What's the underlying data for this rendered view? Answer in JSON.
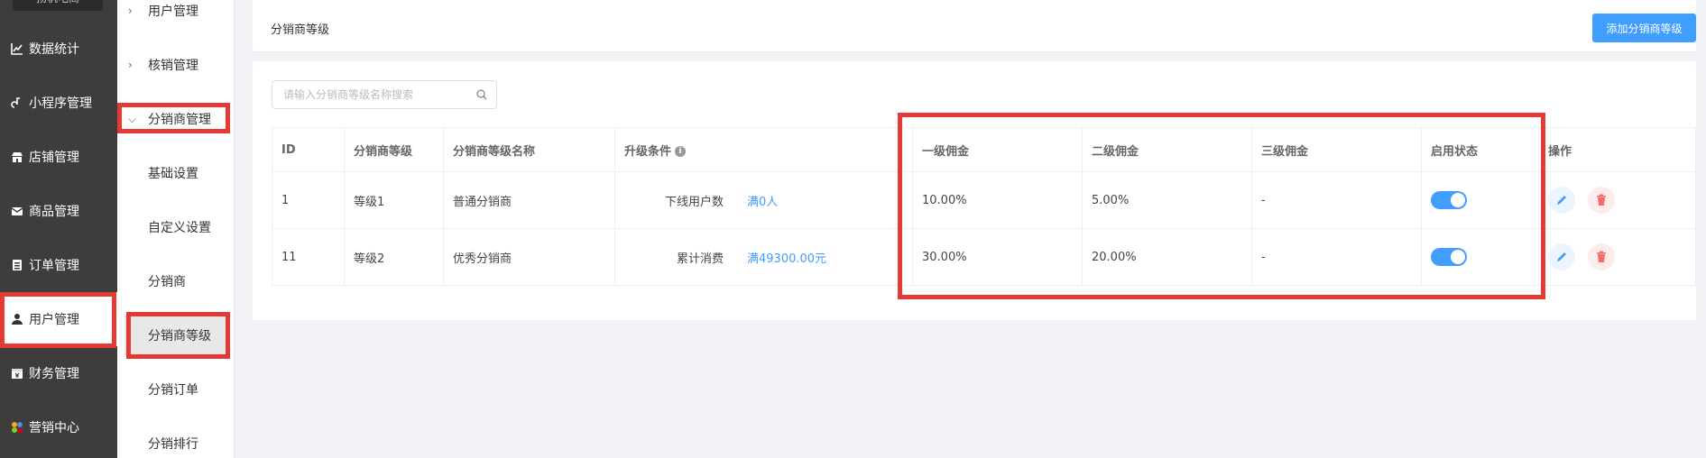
{
  "sidebar": {
    "logo_text": "扬帆电商",
    "items": [
      {
        "label": "数据统计",
        "icon": "chart-line-icon"
      },
      {
        "label": "小程序管理",
        "icon": "link-icon"
      },
      {
        "label": "店铺管理",
        "icon": "store-icon"
      },
      {
        "label": "商品管理",
        "icon": "mail-icon"
      },
      {
        "label": "订单管理",
        "icon": "list-icon"
      },
      {
        "label": "用户管理",
        "icon": "user-icon"
      },
      {
        "label": "财务管理",
        "icon": "finance-icon"
      },
      {
        "label": "营销中心",
        "icon": "marketing-icon"
      }
    ]
  },
  "subnav": {
    "groups": [
      {
        "label": "用户管理"
      },
      {
        "label": "核销管理"
      },
      {
        "label": "分销商管理"
      }
    ],
    "items": [
      {
        "label": "基础设置"
      },
      {
        "label": "自定义设置"
      },
      {
        "label": "分销商"
      },
      {
        "label": "分销商等级"
      },
      {
        "label": "分销订单"
      },
      {
        "label": "分销排行"
      }
    ]
  },
  "header": {
    "title": "分销商等级",
    "add_button": "添加分销商等级"
  },
  "search": {
    "placeholder": "请输入分销商等级名称搜索"
  },
  "table": {
    "columns": [
      "ID",
      "分销商等级",
      "分销商等级名称",
      "升级条件",
      "一级佣金",
      "二级佣金",
      "三级佣金",
      "启用状态",
      "操作"
    ],
    "rows": [
      {
        "id": "1",
        "level": "等级1",
        "name": "普通分销商",
        "cond_label": "下线用户数",
        "cond_value": "满0人",
        "c1": "10.00%",
        "c2": "5.00%",
        "c3": "-",
        "enabled": true
      },
      {
        "id": "11",
        "level": "等级2",
        "name": "优秀分销商",
        "cond_label": "累计消费",
        "cond_value": "满49300.00元",
        "c1": "30.00%",
        "c2": "20.00%",
        "c3": "-",
        "enabled": true
      }
    ]
  },
  "colors": {
    "primary": "#409eff",
    "sidebar_bg": "#3d3d3d",
    "annotation_red": "#e53935",
    "delete_red": "#f56c6c"
  }
}
